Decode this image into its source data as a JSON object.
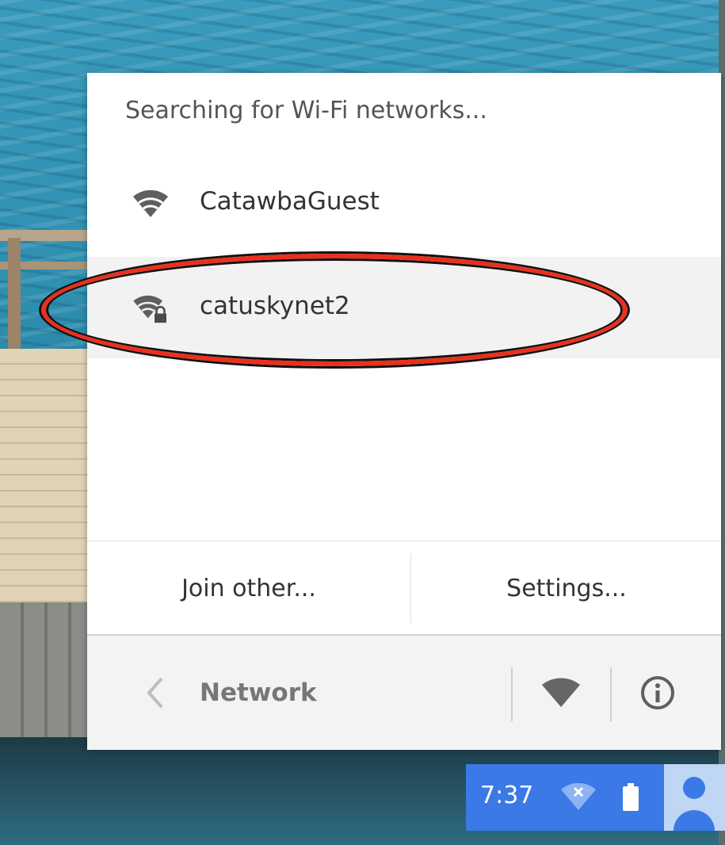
{
  "popup": {
    "status_text": "Searching for Wi-Fi networks...",
    "networks": [
      {
        "name": "CatawbaGuest",
        "secured": false
      },
      {
        "name": "catuskynet2",
        "secured": true,
        "highlighted": true
      }
    ],
    "join_other_label": "Join other...",
    "settings_label": "Settings...",
    "footer": {
      "title": "Network",
      "icons": [
        "back-icon",
        "wifi-toggle-icon",
        "info-icon"
      ]
    }
  },
  "tray": {
    "time": "7:37",
    "icons": [
      "wifi-disconnected-icon",
      "battery-icon",
      "user-avatar"
    ]
  },
  "colors": {
    "tray_blue": "#3b79e6",
    "annotation_red": "#e9301c",
    "icon_gray": "#5f5f5f"
  }
}
